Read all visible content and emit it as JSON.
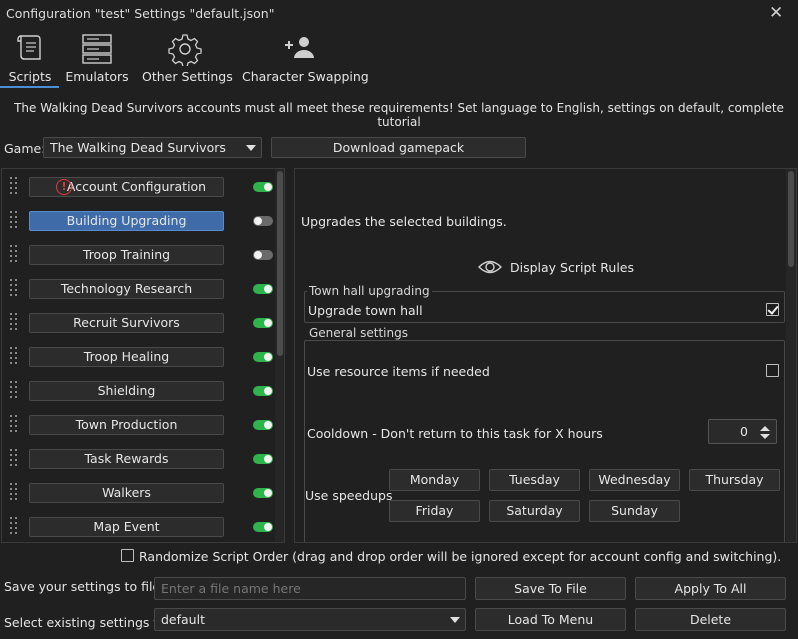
{
  "window": {
    "title": "Configuration \"test\" Settings \"default.json\"",
    "close_glyph": "✕"
  },
  "tabs": [
    {
      "label": "Scripts",
      "icon": "scroll-icon",
      "active": true
    },
    {
      "label": "Emulators",
      "icon": "server-icon"
    },
    {
      "label": "Other Settings",
      "icon": "gear-icon"
    },
    {
      "label": "Character Swapping",
      "icon": "add-user-icon"
    }
  ],
  "requirements_text": "The Walking Dead Survivors accounts must all meet these requirements! Set language to English, settings on default, complete tutorial",
  "game": {
    "label": "Game:",
    "selected": "The Walking Dead Survivors",
    "download_label": "Download gamepack"
  },
  "scripts": [
    {
      "label": "Account Configuration",
      "enabled": true,
      "warning": true,
      "warning_glyph": "!"
    },
    {
      "label": "Building Upgrading",
      "enabled": false,
      "selected": true
    },
    {
      "label": "Troop Training",
      "enabled": false
    },
    {
      "label": "Technology Research",
      "enabled": true
    },
    {
      "label": "Recruit Survivors",
      "enabled": true
    },
    {
      "label": "Troop Healing",
      "enabled": true
    },
    {
      "label": "Shielding",
      "enabled": true
    },
    {
      "label": "Town Production",
      "enabled": true
    },
    {
      "label": "Task Rewards",
      "enabled": true
    },
    {
      "label": "Walkers",
      "enabled": true
    },
    {
      "label": "Map Event",
      "enabled": true
    }
  ],
  "detail": {
    "description": "Upgrades the selected buildings.",
    "display_rules_label": "Display Script Rules",
    "town_hall_group": {
      "title": "Town hall upgrading",
      "upgrade_label": "Upgrade town hall",
      "upgrade_checked": true
    },
    "general_group": {
      "title": "General settings",
      "resource_label": "Use resource items if needed",
      "resource_checked": false,
      "cooldown_label": "Cooldown - Don't return to this task for X hours",
      "cooldown_value": "0",
      "speedups_label": "Use speedups",
      "days": [
        "Monday",
        "Tuesday",
        "Wednesday",
        "Thursday",
        "Friday",
        "Saturday",
        "Sunday"
      ]
    }
  },
  "randomize": {
    "label": "Randomize Script Order (drag and drop order will be ignored except for account config and switching).",
    "checked": false
  },
  "save": {
    "label": "Save your settings to file",
    "placeholder": "Enter a file name here",
    "save_button": "Save To File",
    "apply_button": "Apply To All"
  },
  "load": {
    "label": "Select existing settings file",
    "selected": "default",
    "load_button": "Load To Menu",
    "delete_button": "Delete"
  },
  "colors": {
    "accent": "#3f6ca8",
    "toggle_on": "#2fb34b",
    "warning": "#e03a3a",
    "tab_underline": "#4a8fd6"
  }
}
